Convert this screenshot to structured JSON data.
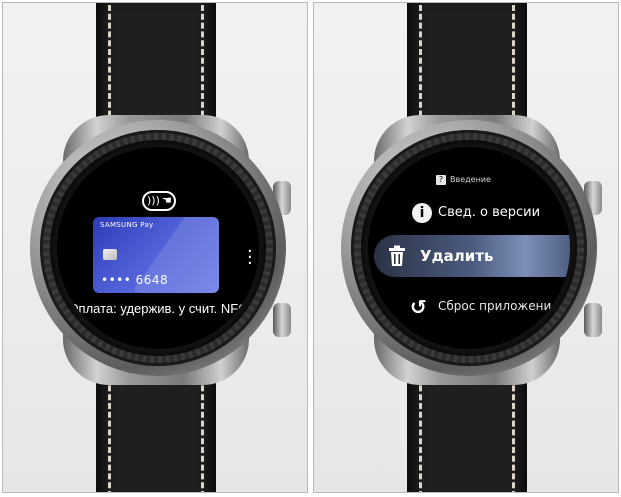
{
  "left_screen": {
    "nfc_icon": "contactless-icon",
    "card": {
      "brand": "SAMSUNG Pay",
      "number": "•••• 6648"
    },
    "more_icon": "more-vertical-icon",
    "message": "Оплата: удержив. у счит. NFC"
  },
  "right_screen": {
    "intro_label": "Введение",
    "items": [
      {
        "label": "Свед. о версии",
        "icon": "info-icon"
      },
      {
        "label": "Удалить",
        "icon": "trash-icon"
      },
      {
        "label": "Сброс приложени",
        "icon": "reset-icon"
      }
    ]
  },
  "colors": {
    "card_blue": "#3d4cc8",
    "selected_row": "#4b5b7e"
  }
}
